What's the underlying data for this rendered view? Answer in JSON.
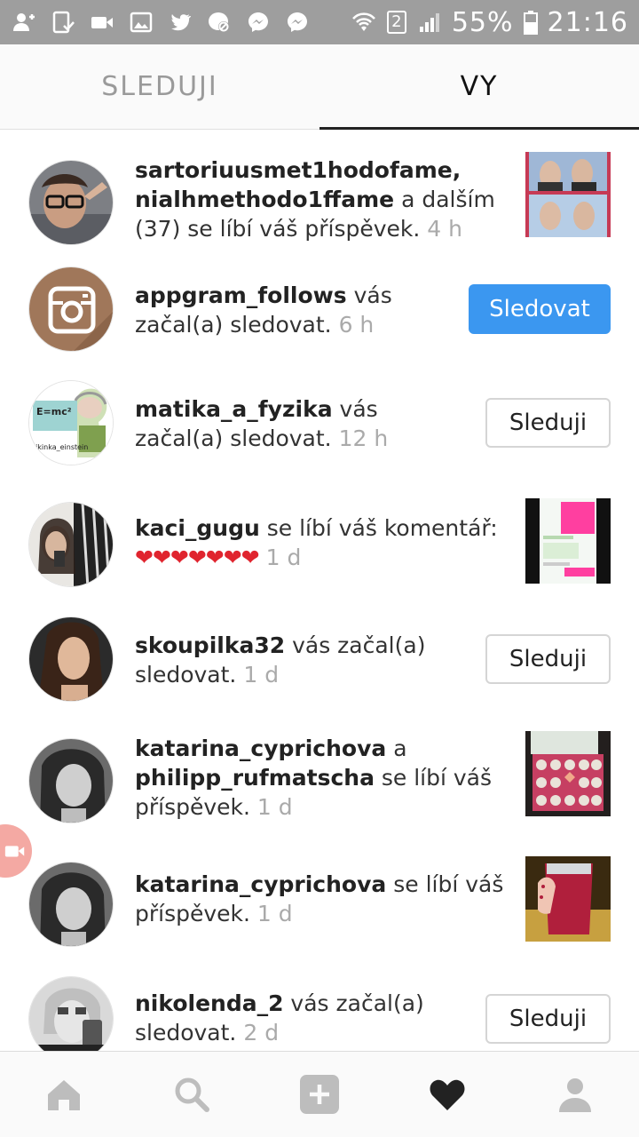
{
  "status_bar": {
    "icons_left": [
      "add-user-icon",
      "tablet-check-icon",
      "video-icon",
      "image-icon",
      "twitter-icon",
      "blocked-messenger-icon",
      "messenger-icon",
      "messenger-icon"
    ],
    "icons_right": [
      "wifi-icon",
      "sim-2-icon",
      "signal-icon"
    ],
    "sim_label": "2",
    "battery": "55%",
    "time": "21:16"
  },
  "tabs": {
    "following": "SLEDUJI",
    "you": "VY",
    "active": "you"
  },
  "notifications": [
    {
      "type": "like",
      "user1": "sartoriuusmet1hodofame,",
      "user2": "nialhmethodo1ffame",
      "text": " a dalším (37) se líbí váš příspěvek.",
      "time": "4 h"
    },
    {
      "type": "follow",
      "user": "appgram_follows",
      "text": " vás začal(a) sledovat.",
      "time": "6 h",
      "button": "Sledovat"
    },
    {
      "type": "follow",
      "user": "matika_a_fyzika",
      "text": " vás začal(a) sledovat.",
      "time": "12 h",
      "button": "Sleduji",
      "avatar_caption": "nikinka_einstein",
      "avatar_formula": "E=mc²"
    },
    {
      "type": "comment-like",
      "user": "kaci_gugu",
      "text": " se líbí váš komentář:",
      "hearts": "❤❤❤❤❤❤❤",
      "time": "1 d"
    },
    {
      "type": "follow",
      "user": "skoupilka32",
      "text": " vás začal(a) sledovat.",
      "time": "1 d",
      "button": "Sleduji"
    },
    {
      "type": "like",
      "user1": "katarina_cyprichova",
      "joiner": " a ",
      "user2": "philipp_rufmatscha",
      "text": " se líbí váš příspěvek.",
      "time": "1 d"
    },
    {
      "type": "like",
      "user": "katarina_cyprichova",
      "text": " se líbí váš příspěvek.",
      "time": "1 d"
    },
    {
      "type": "follow",
      "user": "nikolenda_2",
      "text": " vás začal(a) sledovat.",
      "time": "2 d",
      "button": "Sleduji"
    }
  ],
  "bottom_nav": [
    "home-icon",
    "search-icon",
    "add-post-icon",
    "activity-heart-icon",
    "profile-icon"
  ],
  "colors": {
    "follow_button": "#3b97f0",
    "status_bar": "#9e9e9e",
    "heart": "#e0242e"
  }
}
